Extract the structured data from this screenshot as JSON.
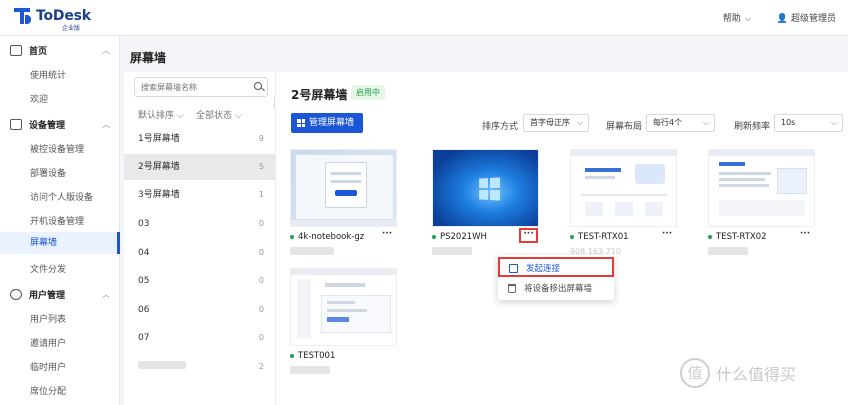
{
  "header": {
    "logo_name": "ToDesk",
    "logo_sub": "企业版",
    "help": "帮助",
    "user": "超级管理员"
  },
  "sidebar": {
    "groups": [
      {
        "label": "首页"
      },
      {
        "label": "设备管理"
      },
      {
        "label": "用户管理"
      }
    ],
    "items": [
      "使用统计",
      "欢迎",
      "被控设备管理",
      "部署设备",
      "访问个人版设备",
      "开机设备管理",
      "屏幕墙",
      "文件分发",
      "用户列表",
      "邀请用户",
      "临时用户",
      "席位分配"
    ]
  },
  "page_title": "屏幕墙",
  "walls": {
    "search_placeholder": "搜索屏幕墙名称",
    "sort": "默认排序",
    "status": "全部状态",
    "list": [
      {
        "name": "1号屏幕墙",
        "count": "9"
      },
      {
        "name": "2号屏幕墙",
        "count": "5"
      },
      {
        "name": "3号屏幕墙",
        "count": "1"
      },
      {
        "name": "03",
        "count": "0"
      },
      {
        "name": "04",
        "count": "0"
      },
      {
        "name": "05",
        "count": "0"
      },
      {
        "name": "06",
        "count": "0"
      },
      {
        "name": "07",
        "count": "0"
      },
      {
        "name": "",
        "count": "2"
      }
    ]
  },
  "content": {
    "title": "2号屏幕墙",
    "status_badge": "启用中",
    "manage_button": "管理屏幕墙",
    "sort_label": "排序方式",
    "sort_value": "首字母正序",
    "layout_label": "屏幕布局",
    "layout_value": "每行4个",
    "refresh_label": "刷新频率",
    "refresh_value": "10s"
  },
  "devices": [
    {
      "name": "4k-notebook-gz"
    },
    {
      "name": "PS2021WH"
    },
    {
      "name": "TEST-RTX01",
      "id": "908 163 710"
    },
    {
      "name": "TEST-RTX02"
    },
    {
      "name": "TEST001"
    }
  ],
  "context_menu": {
    "connect": "发起连接",
    "remove": "将设备移出屏幕墙"
  },
  "watermark": "什么值得买",
  "colors": {
    "accent": "#1a56d6",
    "online": "#21a043",
    "highlight": "#e53a3a"
  }
}
